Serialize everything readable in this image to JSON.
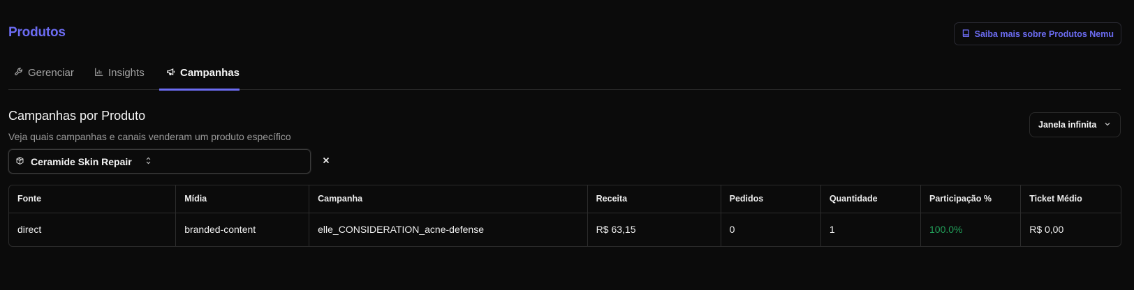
{
  "header": {
    "title": "Produtos",
    "help_label": "Saiba mais sobre Produtos Nemu"
  },
  "tabs": [
    {
      "label": "Gerenciar",
      "icon": "wrench-icon",
      "active": false
    },
    {
      "label": "Insights",
      "icon": "bar-chart-icon",
      "active": false
    },
    {
      "label": "Campanhas",
      "icon": "megaphone-icon",
      "active": true
    }
  ],
  "section": {
    "title": "Campanhas por Produto",
    "subtitle": "Veja quais campanhas e canais venderam um produto específico",
    "window_select": "Janela infinita"
  },
  "product_filter": {
    "value": "Ceramide Skin Repair",
    "icon": "package-icon"
  },
  "table": {
    "columns": [
      "Fonte",
      "Mídia",
      "Campanha",
      "Receita",
      "Pedidos",
      "Quantidade",
      "Participação %",
      "Ticket Médio"
    ],
    "rows": [
      [
        "direct",
        "branded-content",
        "elle_CONSIDERATION_acne-defense",
        "R$ 63,15",
        "0",
        "1",
        "100.0%",
        "R$ 0,00"
      ]
    ]
  },
  "colors": {
    "accent": "#6c6cf2",
    "background": "#0b0b0b",
    "positive": "#22a05a"
  }
}
